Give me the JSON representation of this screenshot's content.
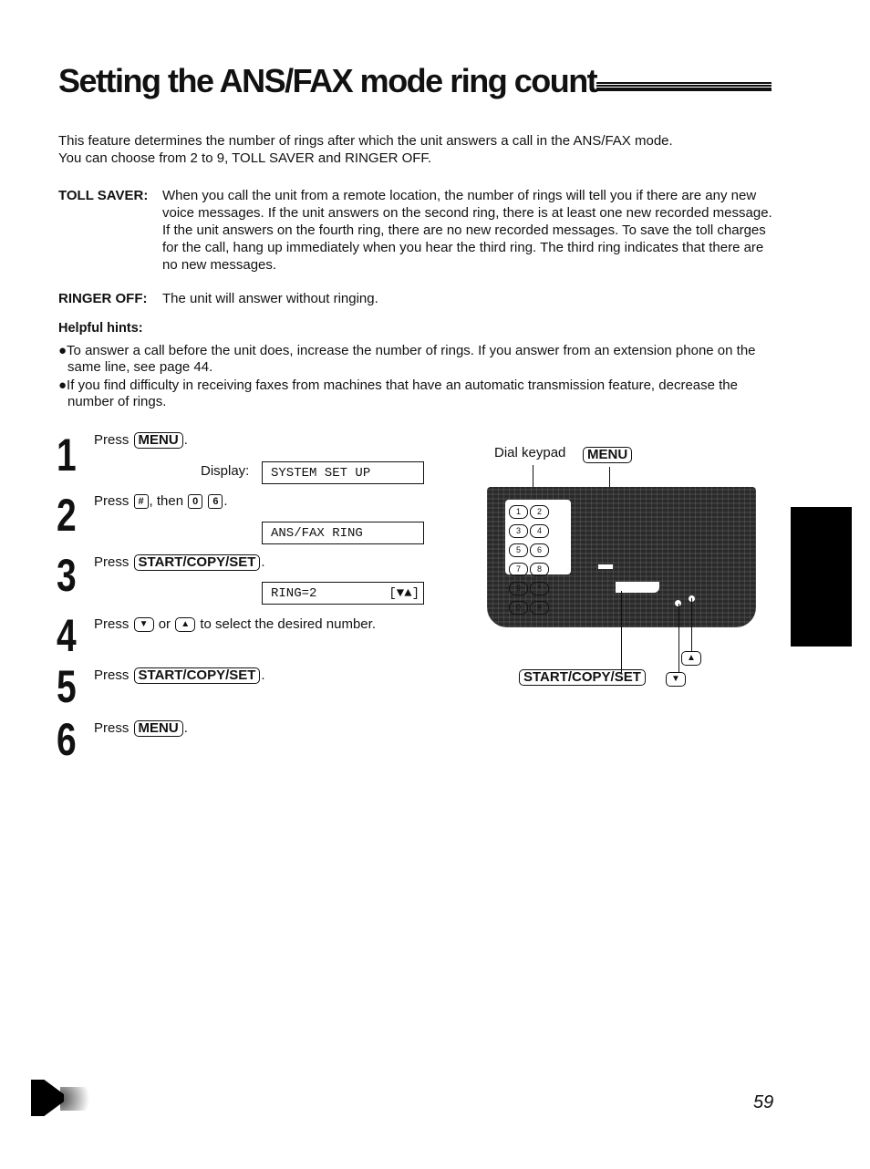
{
  "title": "Setting the ANS/FAX mode ring count",
  "intro": {
    "line1": "This feature determines the number of rings after which the unit answers a call in the ANS/FAX mode.",
    "line2": "You can choose from 2 to 9, TOLL SAVER and RINGER OFF."
  },
  "definitions": [
    {
      "label": "TOLL SAVER:",
      "text": "When you call the unit from a remote location, the number of rings will tell you if there are any new voice messages. If the unit answers on the second ring, there is at least one new recorded message. If the unit answers on the fourth ring, there are no new recorded messages. To save the toll charges for the call, hang up immediately when you hear the third ring. The third ring indicates that there are no new messages."
    },
    {
      "label": "RINGER OFF:",
      "text": "The unit will answer without ringing."
    }
  ],
  "hints": {
    "title": "Helpful hints:",
    "items": [
      "●To answer a call before the unit does, increase the number of rings. If you answer from an extension phone on the same line, see page 44.",
      "●If you find difficulty in receiving faxes from machines that have an automatic transmission feature, decrease the number of rings."
    ]
  },
  "steps": [
    {
      "num": "1",
      "press": "Press",
      "key": "MENU",
      "after": "."
    },
    {
      "num": "2",
      "press": "Press",
      "key1": "#",
      "mid": ", then",
      "key2": "0",
      "key3": "6",
      "after": "."
    },
    {
      "num": "3",
      "press": "Press",
      "key": "START/COPY/SET",
      "after": "."
    },
    {
      "num": "4",
      "press": "Press",
      "down": "▼",
      "or": "or",
      "up": "▲",
      "after": "to select the desired number."
    },
    {
      "num": "5",
      "press": "Press",
      "key": "START/COPY/SET",
      "after": "."
    },
    {
      "num": "6",
      "press": "Press",
      "key": "MENU",
      "after": "."
    }
  ],
  "display": {
    "label": "Display:",
    "screens": [
      "SYSTEM SET UP",
      "ANS/FAX RING",
      "RING=2"
    ],
    "arrows": "[▼▲]"
  },
  "diagram": {
    "dial_keypad_label": "Dial keypad",
    "menu_label": "MENU",
    "start_label": "START/COPY/SET",
    "up_label": "▲",
    "down_label": "▼",
    "keypad": [
      "1",
      "2",
      "3",
      "4",
      "5",
      "6",
      "7",
      "8",
      "9",
      "*",
      "0",
      "#"
    ]
  },
  "page_number": "59"
}
